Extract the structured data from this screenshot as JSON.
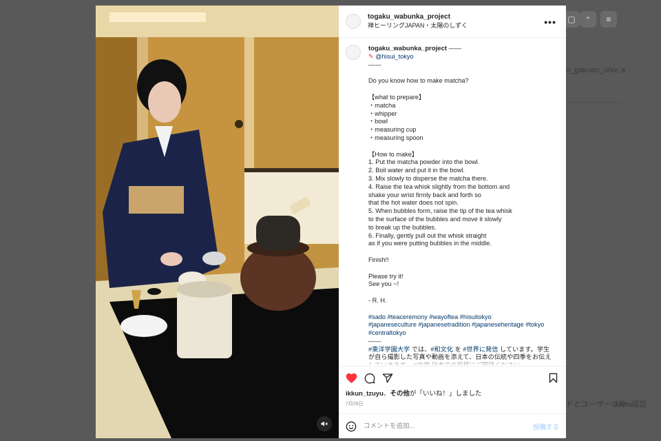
{
  "background": {
    "side_text_1": "o_gakuen_univ, a",
    "footer_text_1": "ドとユーザー以外",
    "footer_text_2": "Meta認証"
  },
  "post": {
    "username": "togaku_wabunka_project",
    "subline": "禅ヒーリングJAPAN・太陽のしずく",
    "caption": {
      "username": "togaku_wabunka_project",
      "after_name": " ——",
      "mention": "@hisui_tokyo",
      "rule": "——",
      "body": "Do you know how to make matcha?\n\n【what to prepare】\n・matcha\n・whipper\n・bowl\n・measuring cup\n・measuring spoon\n\n 【How to make】\n1. Put the matcha powder into the bowl.\n2. Boil water and put it in the bowl.\n3. Mix slowly to disperse the matcha there.\n4. Raise the tea whisk slightly from the bottom and\nshake your wrist firmly back and forth so\n that the hot water does not spin.\n5. When bubbles form, raise the tip of the tea whisk\nto the surface of the bubbles and move it slowly\nto break up the bubbles.\n6. Finally, gently pull out the whisk straight\nas if you were putting bubbles in the middle.\n\nFinish!!\n\nPlease try it!\nSee you ~!\n\n- R. H.\n\n",
      "hashtags": "#sado #teaceremony #wayoftea #hisuitokyo\n#japaneseculture #japanesetradition #japaneseheritage #tokyo\n#centraltokyo",
      "rule2": "——",
      "jp_tag_1": "#東洋学園大学",
      "jp_text_1": " では、",
      "jp_tag_2": "#和文化",
      "jp_text_2": " を ",
      "jp_tag_3": "#世界に発信",
      "jp_text_3": " しています。学生が自ら撮影した写真や動画を添えて、日本の伝統や四季をお伝えしていきます。 #文学 日本での投稿にご期待ください。"
    },
    "likes": {
      "user": "ikkun_tzuyu",
      "sep": "、",
      "others": "その他",
      "suffix": "が「いいね！」しました"
    },
    "date": "7月28日",
    "comment": {
      "placeholder": "コメントを追加...",
      "post_label": "投稿する"
    }
  },
  "colors": {
    "like_red": "#ff3040",
    "link_blue": "#00376b",
    "overlay": "#595959"
  },
  "icons": [
    "more-icon",
    "heart-icon",
    "comment-icon",
    "share-icon",
    "bookmark-icon",
    "emoji-icon",
    "muted-audio-icon"
  ]
}
